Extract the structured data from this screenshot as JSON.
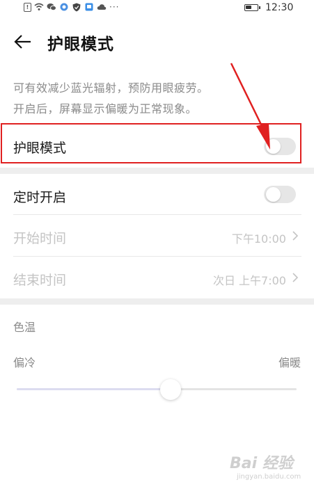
{
  "status_bar": {
    "time": "12:30",
    "battery_level": 0.55,
    "icons": [
      "sim-alert-icon",
      "wifi-icon",
      "wechat-icon",
      "app-icon",
      "shield-icon",
      "app-icon",
      "cloud-icon"
    ],
    "more": "···"
  },
  "header": {
    "title": "护眼模式"
  },
  "description": {
    "line1": "可有效减少蓝光辐射，预防用眼疲劳。",
    "line2": "开启后，屏幕显示偏暖为正常现象。"
  },
  "eye_comfort": {
    "label": "护眼模式",
    "enabled": false
  },
  "schedule": {
    "label": "定时开启",
    "enabled": false,
    "start_label": "开始时间",
    "start_value": "下午10:00",
    "end_label": "结束时间",
    "end_value": "次日 上午7:00"
  },
  "color_temp": {
    "title": "色温",
    "cool_label": "偏冷",
    "warm_label": "偏暖",
    "level": 0.55
  },
  "watermark": {
    "text": "Bai 经验",
    "sub": "jingyan.baidu.com"
  },
  "colors": {
    "highlight": "#e02020",
    "arrow": "#e02020"
  }
}
